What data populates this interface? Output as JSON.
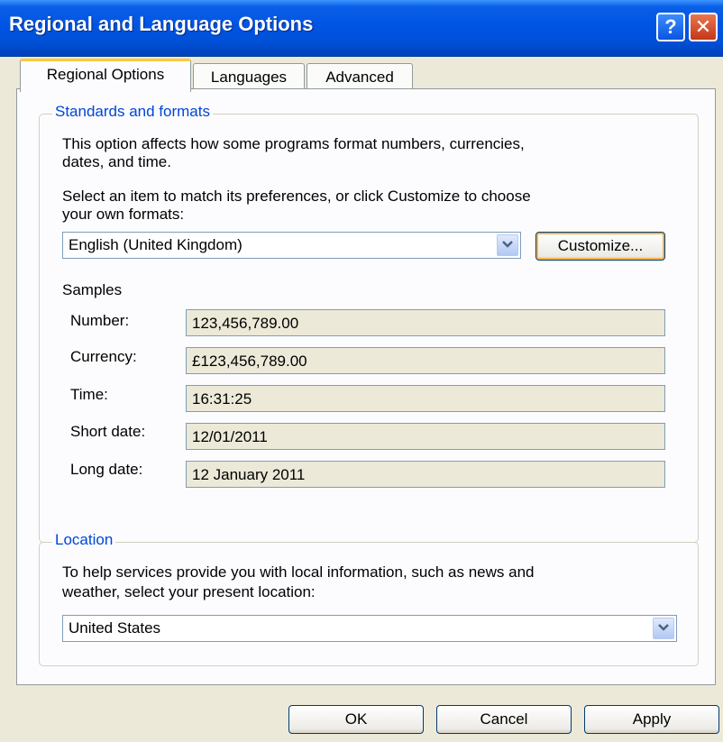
{
  "window": {
    "title": "Regional and Language Options",
    "help": "?",
    "close": "✕"
  },
  "tabs": [
    {
      "label": "Regional Options",
      "active": true
    },
    {
      "label": "Languages",
      "active": false
    },
    {
      "label": "Advanced",
      "active": false
    }
  ],
  "standards": {
    "group_label": "Standards and formats",
    "desc1": "This option affects how some programs format numbers, currencies,",
    "desc2": "dates, and time.",
    "desc3": "Select an item to match its preferences, or click Customize to choose",
    "desc4": "your own formats:",
    "selected_format": "English (United Kingdom)",
    "customize_label": "Customize...",
    "samples_label": "Samples",
    "samples": [
      {
        "label": "Number:",
        "value": "123,456,789.00"
      },
      {
        "label": "Currency:",
        "value": "£123,456,789.00"
      },
      {
        "label": "Time:",
        "value": "16:31:25"
      },
      {
        "label": "Short date:",
        "value": "12/01/2011"
      },
      {
        "label": "Long date:",
        "value": "12 January 2011"
      }
    ]
  },
  "location": {
    "group_label": "Location",
    "desc1": "To help services provide you with local information, such as news and",
    "desc2": "weather, select your present location:",
    "selected_location": "United States"
  },
  "footer": {
    "ok_label": "OK",
    "cancel_label": "Cancel",
    "apply_label": "Apply"
  },
  "icons": {
    "dropdown": "chevron-down-icon"
  }
}
